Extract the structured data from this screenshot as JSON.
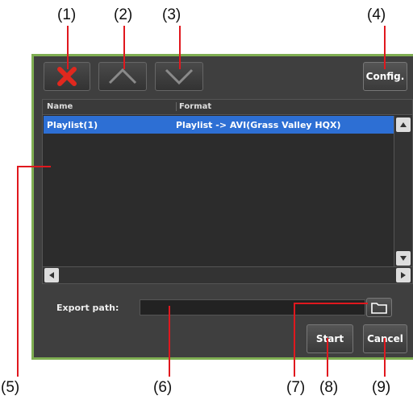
{
  "callouts": [
    "(1)",
    "(2)",
    "(3)",
    "(4)",
    "(5)",
    "(6)",
    "(7)",
    "(8)",
    "(9)"
  ],
  "toolbar": {
    "config_label": "Config."
  },
  "table": {
    "columns": [
      "Name",
      "Format"
    ],
    "rows": [
      {
        "name": "Playlist(1)",
        "format": "Playlist -> AVI(Grass Valley HQX)",
        "selected": true
      }
    ]
  },
  "export": {
    "label": "Export path:",
    "value": ""
  },
  "actions": {
    "start_label": "Start",
    "cancel_label": "Cancel"
  },
  "colors": {
    "accent_green": "#7fae52",
    "selection": "#2d6fd4",
    "callout_line": "#e0181e",
    "delete_x": "#e0281e"
  },
  "icons": [
    "delete-icon",
    "move-up-icon",
    "move-down-icon",
    "folder-icon",
    "scroll-up-icon",
    "scroll-down-icon",
    "scroll-left-icon",
    "scroll-right-icon"
  ]
}
